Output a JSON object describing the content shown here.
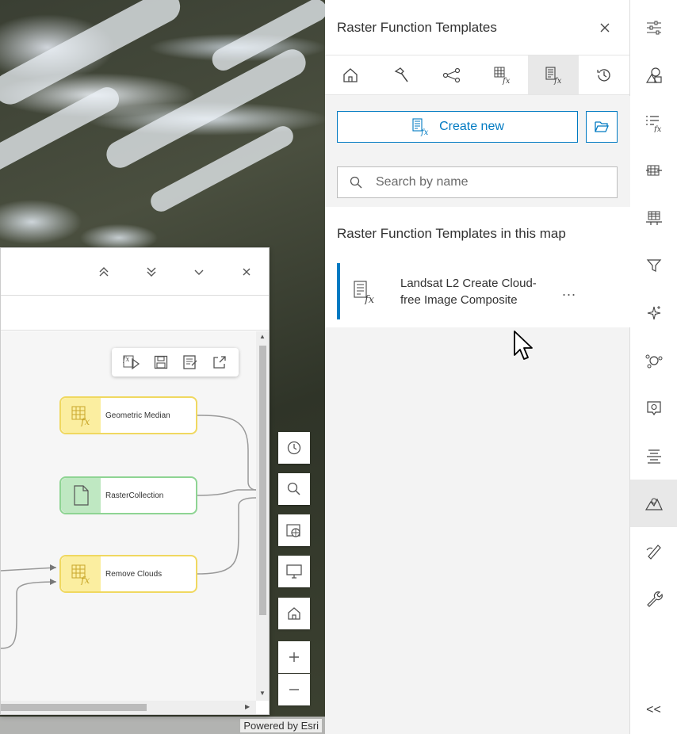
{
  "map": {
    "attribution": "Powered by Esri"
  },
  "model_builder": {
    "nodes": [
      {
        "label": "Geometric Median",
        "kind": "function"
      },
      {
        "label": "RasterCollection",
        "kind": "data"
      },
      {
        "label": "Remove Clouds",
        "kind": "function"
      }
    ],
    "toolbar_icons": [
      "run-function-icon",
      "save-icon",
      "save-as-icon",
      "export-icon"
    ],
    "header_icons": [
      "collapse-all-icon",
      "expand-all-icon",
      "chevron-down-icon",
      "close-icon"
    ]
  },
  "map_controls": [
    "history-icon",
    "search-icon",
    "basemap-icon",
    "display-icon",
    "home-icon",
    "zoom-in-icon",
    "zoom-out-icon"
  ],
  "panel": {
    "title": "Raster Function Templates",
    "tabs": [
      "home-icon",
      "hammer-icon",
      "nodes-icon",
      "raster-function-icon",
      "raster-function-template-icon",
      "history-icon"
    ],
    "active_tab": 4,
    "create_new_label": "Create new",
    "search_placeholder": "Search by name",
    "list_heading": "Raster Function Templates in this map",
    "templates": [
      {
        "label": "Landsat L2 Create Cloud-free Image Composite"
      }
    ],
    "more_label": "..."
  },
  "action_bar": {
    "items": [
      "sliders-icon",
      "shapes-icon",
      "function-list-icon",
      "raster-grid-icon",
      "band-icon",
      "filter-icon",
      "sparkle-icon",
      "cluster-icon",
      "settings-frame-icon",
      "legend-icon",
      "terrain-icon",
      "measure-icon",
      "wrench-icon"
    ],
    "active_index": 10,
    "collapse_label": "<<"
  },
  "colors": {
    "accent": "#007ac2",
    "function_node": "#f0d860",
    "data_node": "#8ed493"
  }
}
